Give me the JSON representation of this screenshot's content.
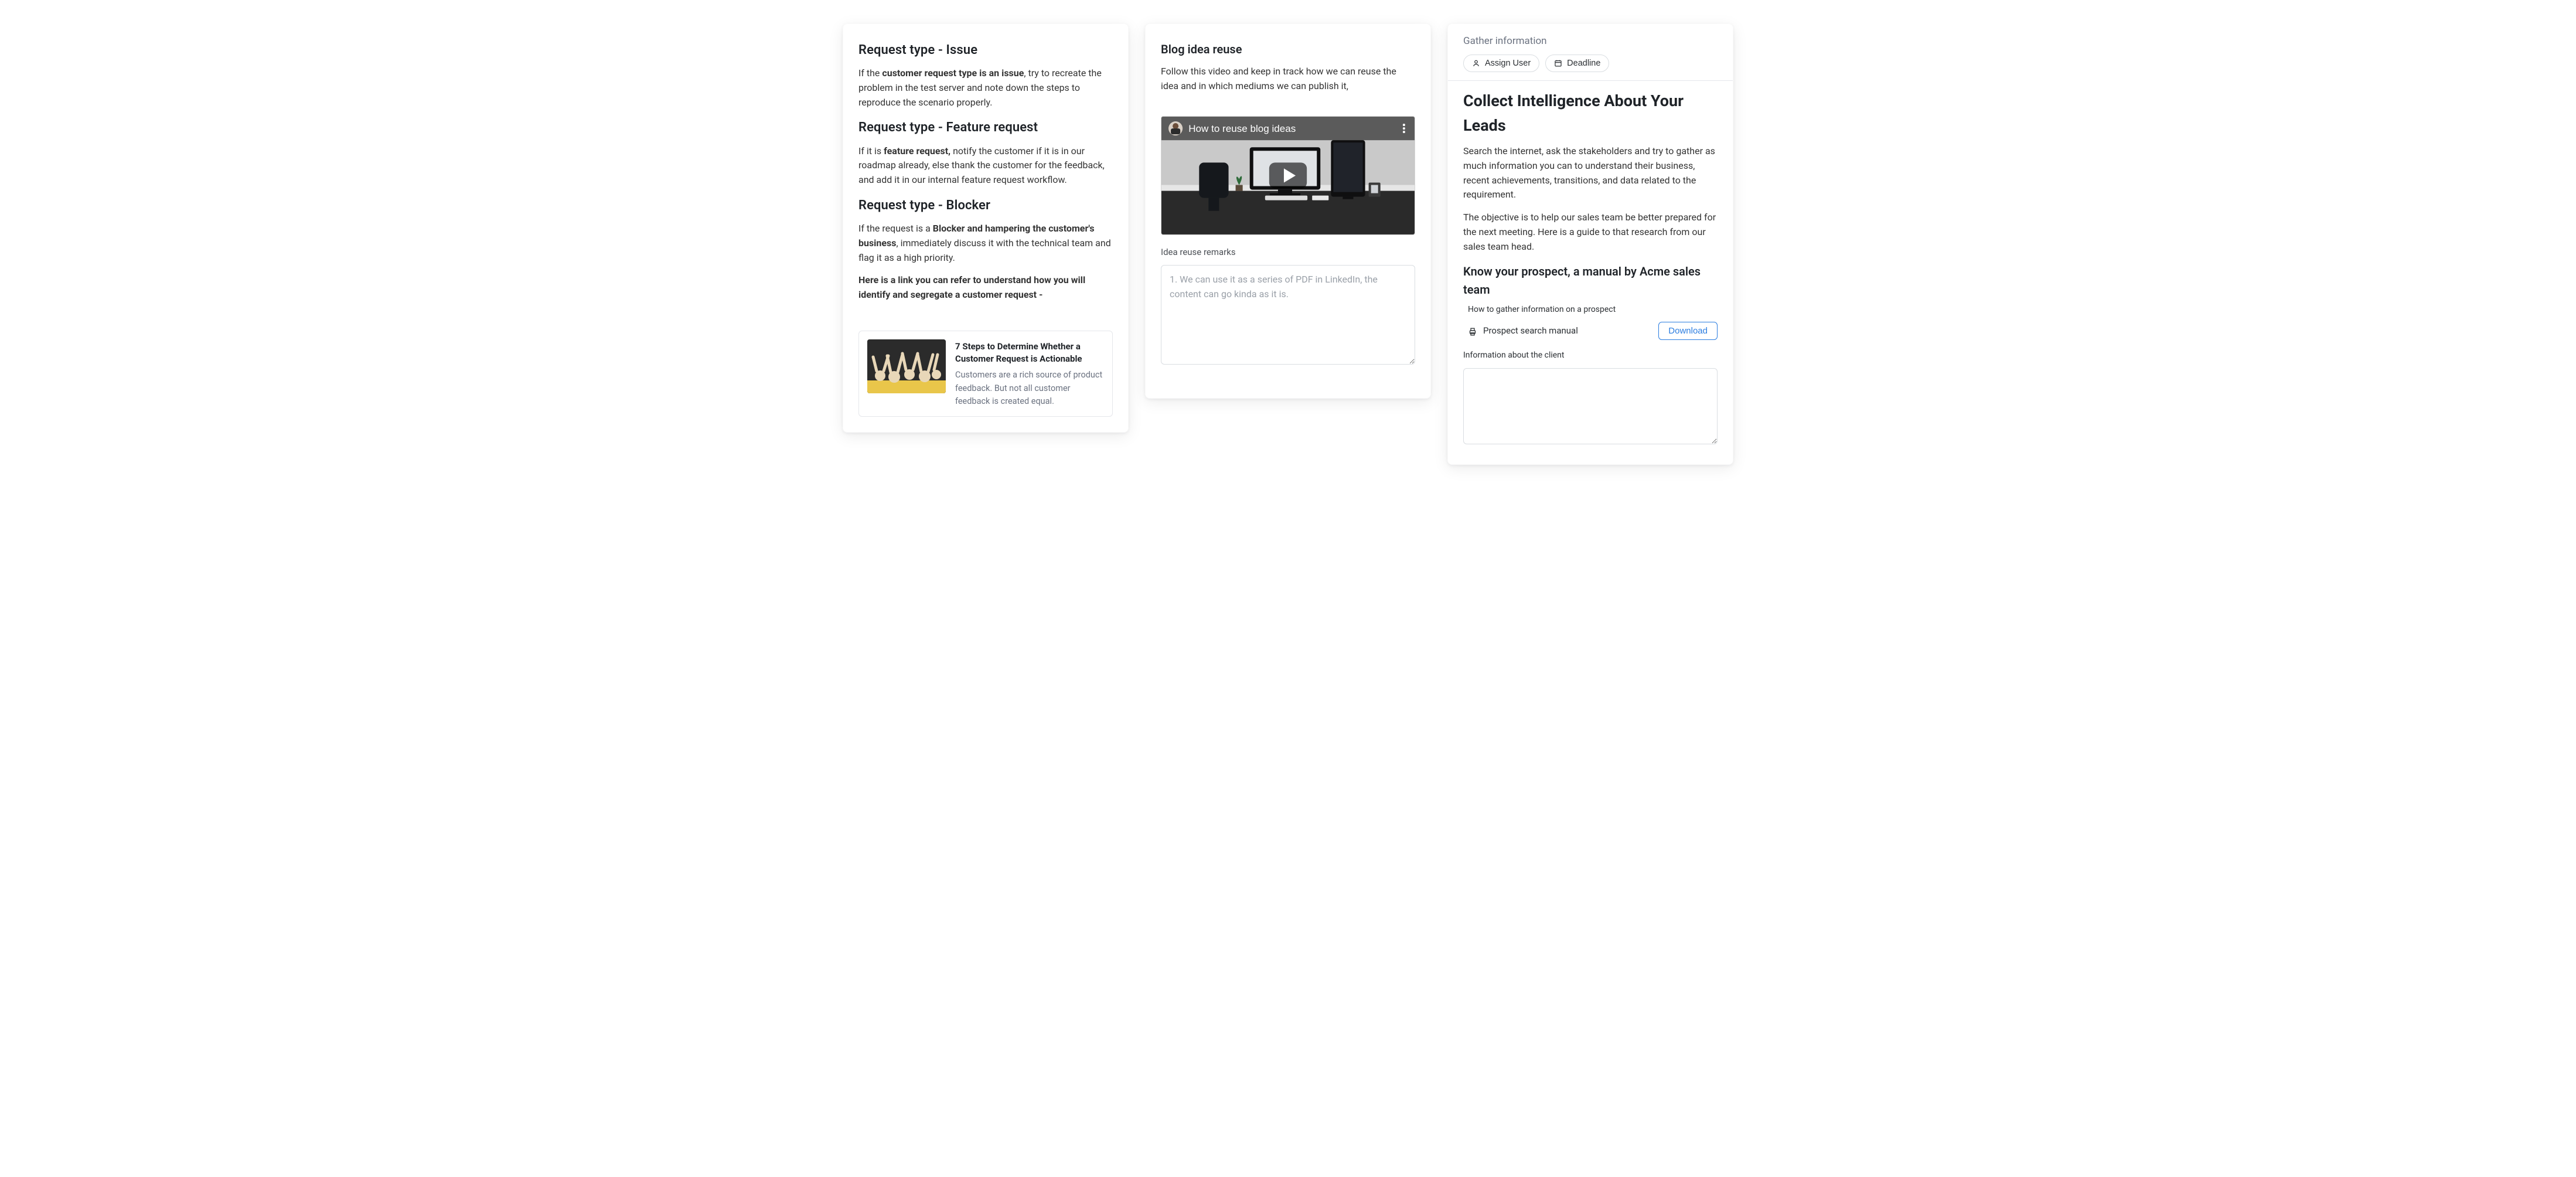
{
  "card1": {
    "h1": "Request type - Issue",
    "p1_a": "If the ",
    "p1_b": "customer request type is an issue",
    "p1_c": ", try to recreate the problem in the test server and note down the steps to reproduce the scenario properly.",
    "h2": "Request type - Feature request",
    "p2_a": "If it is ",
    "p2_b": "feature request,",
    "p2_c": " notify the customer if it is in our roadmap already, else thank the customer for the feedback, and add it in our internal feature request workflow.",
    "h3": "Request type - Blocker",
    "p3_a": "If the request is a ",
    "p3_b": "Blocker and hampering the customer's business",
    "p3_c": ", immediately discuss it with the technical team and flag it as a high priority.",
    "p4": "Here is a link you can refer to understand how you will identify and segregate a customer request -",
    "resource": {
      "title": "7 Steps to Determine Whether a Customer Request is Actionable",
      "desc": "Customers are a rich source of product feedback. But not all customer feedback is created equal."
    }
  },
  "card2": {
    "title": "Blog idea reuse",
    "intro": "Follow this video and keep in track how we can reuse the idea and in which mediums we can publish it,",
    "video_title": "How to reuse blog ideas",
    "remarks_label": "Idea reuse remarks",
    "remarks_placeholder": "1. We can use it as a series of PDF in LinkedIn, the content can go kinda as it is."
  },
  "card3": {
    "section": "Gather information",
    "pill_assign": "Assign User",
    "pill_deadline": "Deadline",
    "title": "Collect Intelligence About Your Leads",
    "p1": "Search the internet, ask the stakeholders and try to gather as much information you can to understand their business, recent achievements, transitions, and data related to the requirement.",
    "p2": "The objective is to help our sales team be better prepared for the next meeting. Here is a guide to that research from our sales team head.",
    "subhead": "Know your prospect, a manual by Acme sales team",
    "subnote": "How to gather information on a prospect",
    "file_name": "Prospect search manual",
    "download": "Download",
    "info_label": "Information about the client"
  }
}
